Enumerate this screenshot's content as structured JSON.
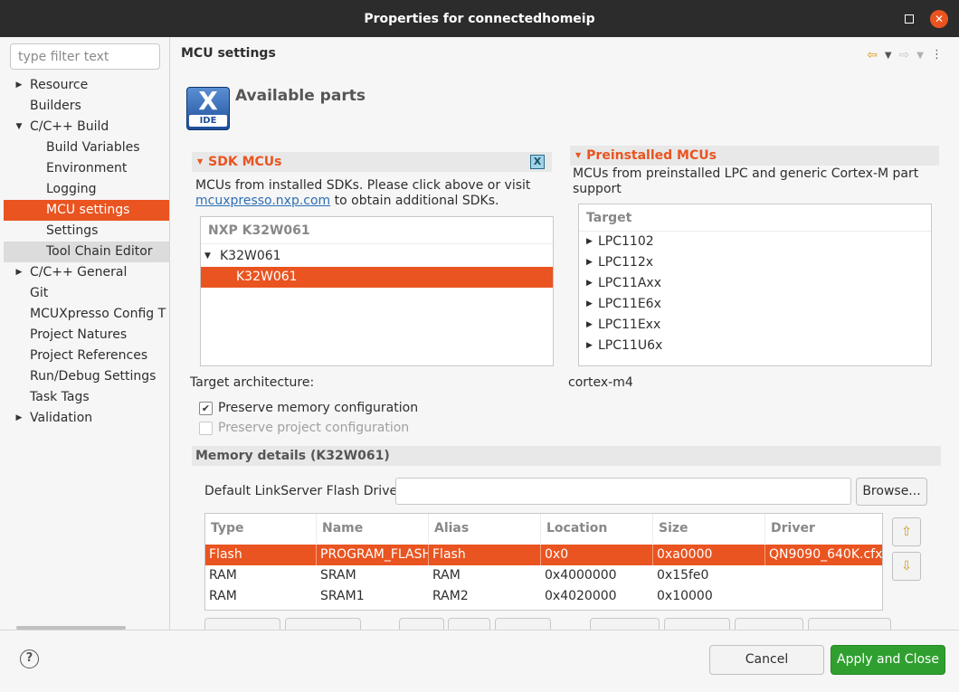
{
  "window": {
    "title": "Properties for connectedhomeip"
  },
  "sidebar": {
    "filter_placeholder": "type filter text",
    "items": [
      {
        "label": "Resource",
        "expandable": true
      },
      {
        "label": "Builders"
      },
      {
        "label": "C/C++ Build",
        "expanded": true
      },
      {
        "label": "Build Variables"
      },
      {
        "label": "Environment"
      },
      {
        "label": "Logging"
      },
      {
        "label": "MCU settings",
        "selected": true
      },
      {
        "label": "Settings"
      },
      {
        "label": "Tool Chain Editor"
      },
      {
        "label": "C/C++ General",
        "expandable": true
      },
      {
        "label": "Git"
      },
      {
        "label": "MCUXpresso Config T"
      },
      {
        "label": "Project Natures"
      },
      {
        "label": "Project References"
      },
      {
        "label": "Run/Debug Settings"
      },
      {
        "label": "Task Tags"
      },
      {
        "label": "Validation",
        "expandable": true
      }
    ]
  },
  "page": {
    "title": "MCU settings",
    "available_title": "Available parts",
    "logo_text": "IDE",
    "sdk": {
      "header": "SDK MCUs",
      "desc_line1": "MCUs from installed SDKs. Please click above or visit",
      "link": "mcuxpresso.nxp.com",
      "desc_line2_suffix": "to obtain additional SDKs.",
      "tree_header": "NXP K32W061",
      "tree_parent": "K32W061",
      "tree_child": "K32W061"
    },
    "preinstalled": {
      "header": "Preinstalled MCUs",
      "desc_line1": "MCUs from preinstalled LPC and generic Cortex-M part",
      "desc_line2": "support",
      "table_header": "Target",
      "items": [
        "LPC1102",
        "LPC112x",
        "LPC11Axx",
        "LPC11E6x",
        "LPC11Exx",
        "LPC11U6x"
      ]
    },
    "arch_label": "Target architecture:",
    "arch_value": "cortex-m4",
    "preserve_memory": "Preserve memory configuration",
    "preserve_project": "Preserve project configuration",
    "memory": {
      "header": "Memory details (K32W061)",
      "flash_driver_label": "Default LinkServer Flash Driver",
      "flash_driver_value": "",
      "browse": "Browse...",
      "columns": [
        "Type",
        "Name",
        "Alias",
        "Location",
        "Size",
        "Driver"
      ],
      "rows": [
        [
          "Flash",
          "PROGRAM_FLASH",
          "Flash",
          "0x0",
          "0xa0000",
          "QN9090_640K.cfx"
        ],
        [
          "RAM",
          "SRAM",
          "RAM",
          "0x4000000",
          "0x15fe0",
          ""
        ],
        [
          "RAM",
          "SRAM1",
          "RAM2",
          "0x4020000",
          "0x10000",
          ""
        ]
      ]
    }
  },
  "footer": {
    "cancel": "Cancel",
    "apply": "Apply and Close",
    "help": "?"
  }
}
